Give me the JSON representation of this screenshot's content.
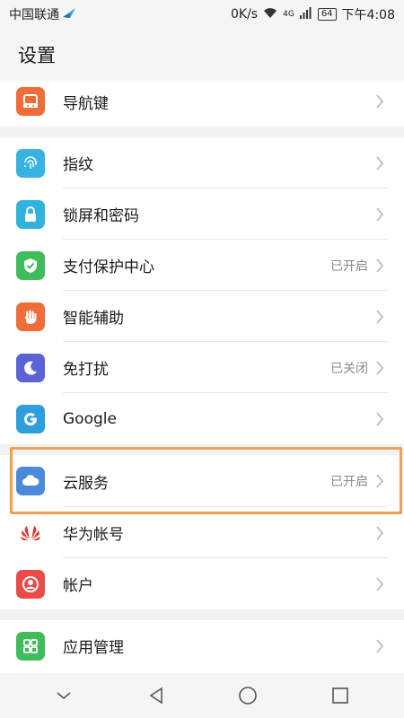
{
  "status_bar": {
    "carrier": "中国联通",
    "speed": "0K/s",
    "network": "4G",
    "battery": "64",
    "time": "下午4:08"
  },
  "header": {
    "title": "设置"
  },
  "groups": [
    {
      "items": [
        {
          "label": "导航键",
          "icon": "navigation-key-icon",
          "color": "#ef6d3a"
        }
      ]
    },
    {
      "items": [
        {
          "label": "指纹",
          "icon": "fingerprint-icon",
          "color": "#36b3e0"
        },
        {
          "label": "锁屏和密码",
          "icon": "lock-icon",
          "color": "#2fb2dc"
        },
        {
          "label": "支付保护中心",
          "icon": "shield-icon",
          "color": "#3fbd5a",
          "status": "已开启"
        },
        {
          "label": "智能辅助",
          "icon": "hand-icon",
          "color": "#ef6d3a"
        },
        {
          "label": "免打扰",
          "icon": "moon-icon",
          "color": "#5a62d6",
          "status": "已关闭"
        },
        {
          "label": "Google",
          "icon": "google-icon",
          "color": "#2f9fdc"
        }
      ]
    },
    {
      "items": [
        {
          "label": "云服务",
          "icon": "cloud-icon",
          "color": "#4a8ad8",
          "status": "已开启"
        },
        {
          "label": "华为帐号",
          "icon": "huawei-logo-icon",
          "color": "#e2302f"
        },
        {
          "label": "帐户",
          "icon": "account-icon",
          "color": "#e94b4b"
        }
      ]
    },
    {
      "items": [
        {
          "label": "应用管理",
          "icon": "apps-grid-icon",
          "color": "#3fbd5a"
        }
      ]
    }
  ],
  "colors": {
    "highlight": "#f0a050",
    "chevron": "#b5b5b5",
    "status_text": "#8a8a8a"
  }
}
